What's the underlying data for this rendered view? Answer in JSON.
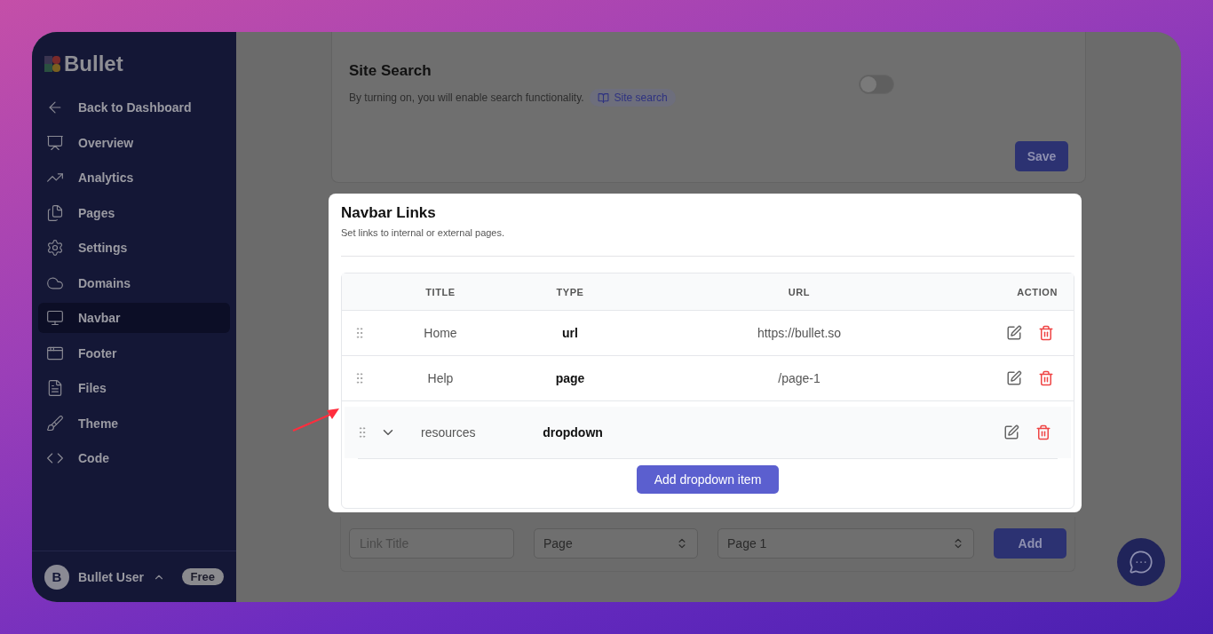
{
  "sidebar": {
    "logo": "Bullet",
    "items": [
      {
        "label": "Back to Dashboard",
        "selected": false
      },
      {
        "label": "Overview",
        "selected": false
      },
      {
        "label": "Analytics",
        "selected": false
      },
      {
        "label": "Pages",
        "selected": false
      },
      {
        "label": "Settings",
        "selected": false
      },
      {
        "label": "Domains",
        "selected": false
      },
      {
        "label": "Navbar",
        "selected": true
      },
      {
        "label": "Footer",
        "selected": false
      },
      {
        "label": "Files",
        "selected": false
      },
      {
        "label": "Theme",
        "selected": false
      },
      {
        "label": "Code",
        "selected": false
      }
    ],
    "user": {
      "initial": "B",
      "name": "Bullet User",
      "plan": "Free"
    }
  },
  "site_search": {
    "title": "Site Search",
    "description": "By turning on, you will enable search functionality.",
    "link": "Site search",
    "on": false,
    "save": "Save"
  },
  "navbar_links": {
    "title": "Navbar Links",
    "description": "Set links to internal or external pages.",
    "columns": [
      "TITLE",
      "TYPE",
      "URL",
      "ACTION"
    ],
    "rows": [
      {
        "kind": "link",
        "title": "Home",
        "type": "url",
        "url": "https://bullet.so"
      },
      {
        "kind": "link",
        "title": "Help",
        "type": "page",
        "url": "/page-1"
      },
      {
        "kind": "dropdown",
        "title": "resources",
        "type": "dropdown",
        "expanded": true
      }
    ],
    "add_dropdown_item": "Add dropdown item"
  },
  "new_link": {
    "title_placeholder": "Link Title",
    "type_value": "Page",
    "page_value": "Page 1",
    "add": "Add"
  }
}
